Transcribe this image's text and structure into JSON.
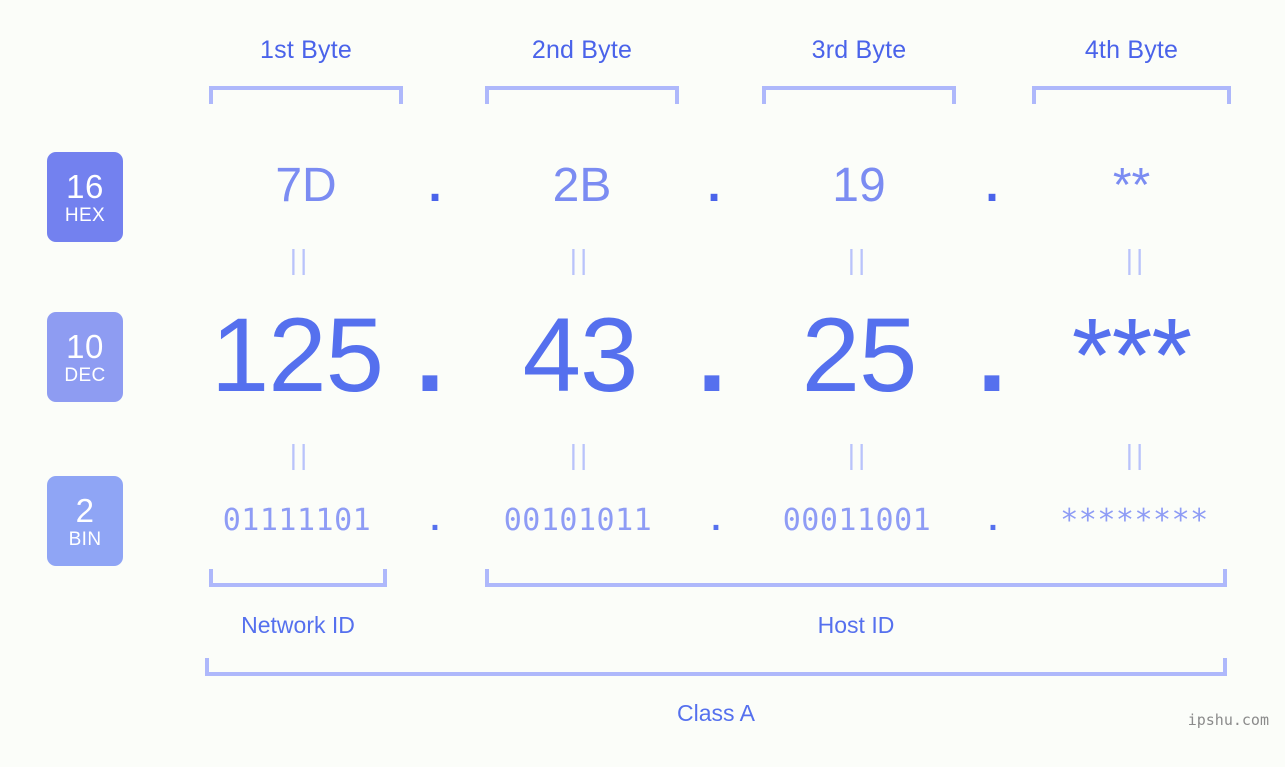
{
  "meta": {
    "background_color": "#fbfdf9",
    "accent_color": "#5570ee",
    "accent_light": "#aeb8fb",
    "badge_hex_color": "#7381ef",
    "badge_dec_color": "#8e9cf2",
    "badge_bin_color": "#8fa5f5",
    "watermark": "ipshu.com"
  },
  "byte_headers": [
    {
      "label": "1st Byte"
    },
    {
      "label": "2nd Byte"
    },
    {
      "label": "3rd Byte"
    },
    {
      "label": "4th Byte"
    }
  ],
  "badges": [
    {
      "num": "16",
      "abbr": "HEX"
    },
    {
      "num": "10",
      "abbr": "DEC"
    },
    {
      "num": "2",
      "abbr": "BIN"
    }
  ],
  "rows": {
    "hex": {
      "values": [
        "7D",
        "2B",
        "19",
        "**"
      ],
      "separators": [
        ".",
        ".",
        "."
      ]
    },
    "dec": {
      "values": [
        "125",
        "43",
        "25",
        "***"
      ],
      "separators": [
        ".",
        ".",
        "."
      ]
    },
    "bin": {
      "values": [
        "01111101",
        "00101011",
        "00011001",
        "********"
      ],
      "separators": [
        ".",
        ".",
        "."
      ]
    }
  },
  "equals_marks": {
    "glyph": "||",
    "count_per_row": 4
  },
  "segments": [
    {
      "label": "Network ID"
    },
    {
      "label": "Host ID"
    }
  ],
  "class_label": "Class A"
}
